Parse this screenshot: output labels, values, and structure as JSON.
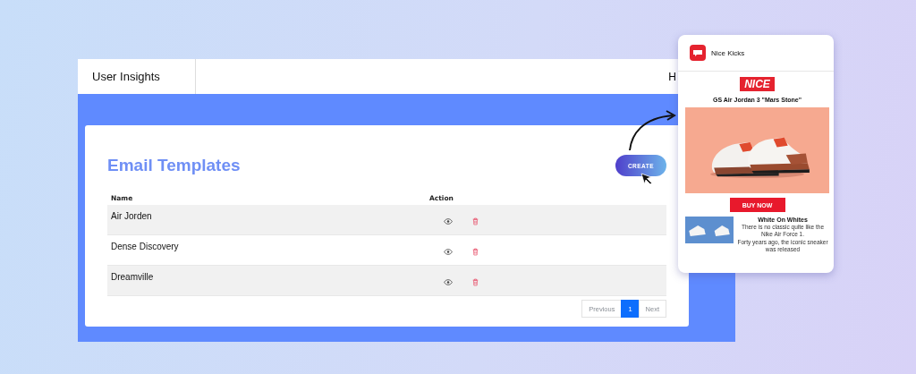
{
  "dashboard": {
    "tab": "User Insights",
    "cut_header_text": "H",
    "card": {
      "title": "Email Templates",
      "create_button": "CREATE",
      "table": {
        "columns": [
          "Name",
          "Action"
        ],
        "rows": [
          {
            "name": "Air Jorden",
            "shaded": true
          },
          {
            "name": "Dense Discovery",
            "shaded": false
          },
          {
            "name": "Dreamville",
            "shaded": true
          }
        ]
      },
      "pagination": [
        {
          "label": "Previous",
          "selected": false
        },
        {
          "label": "1",
          "selected": true
        },
        {
          "label": "Next",
          "selected": false
        }
      ]
    }
  },
  "email_preview": {
    "sender": "Nice Kicks",
    "brand_logo": "NICE",
    "product_title": "GS Air Jordan 3 \"Mars Stone\"",
    "buy_button": "BUY NOW",
    "article": {
      "title": "White On Whites",
      "lines": [
        "There is no classic quite like the Nike Air Force 1.",
        "Forty years ago, the iconic sneaker was released"
      ]
    }
  }
}
